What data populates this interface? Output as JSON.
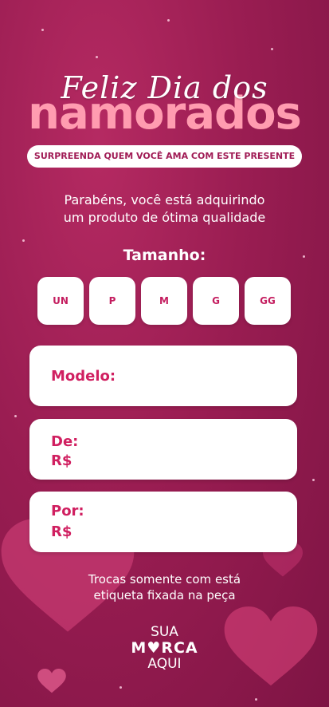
{
  "header": {
    "script_title": "Feliz Dia dos",
    "main_title": "namorados",
    "tagline": "SURPREENDA QUEM VOCÊ AMA COM ESTE PRESENTE"
  },
  "intro": {
    "line1": "Parabéns, você está adquirindo",
    "line2": "um produto de ótima qualidade"
  },
  "sizes": {
    "label": "Tamanho:",
    "options": [
      "UN",
      "P",
      "M",
      "G",
      "GG"
    ]
  },
  "fields": {
    "model_label": "Modelo:",
    "from_label": "De:",
    "from_currency": "R$",
    "to_label": "Por:",
    "to_currency": "R$"
  },
  "note": {
    "line1": "Trocas somente com está",
    "line2": "etiqueta fixada na peça"
  },
  "brand": {
    "line1": "SUA",
    "line2": "M♥RCA",
    "line3": "AQUI"
  },
  "colors": {
    "background": "#9a1d52",
    "accent": "#d01f60",
    "title_pink": "#ff9cb0"
  }
}
